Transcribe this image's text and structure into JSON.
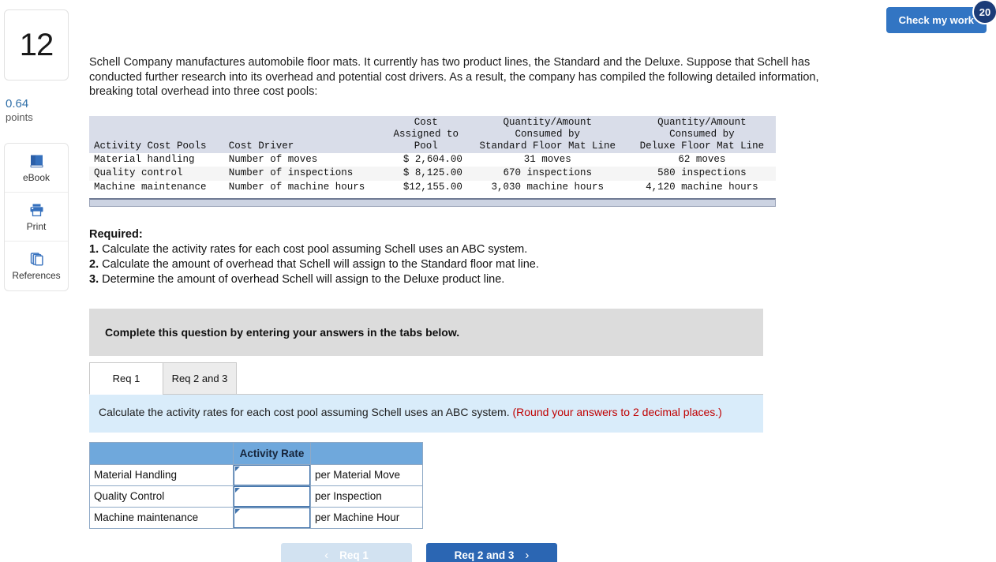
{
  "sidebar": {
    "question_number": "12",
    "points_value": "0.64",
    "points_label": "points",
    "tools": [
      {
        "label": "eBook",
        "icon": "book-icon"
      },
      {
        "label": "Print",
        "icon": "printer-icon"
      },
      {
        "label": "References",
        "icon": "copy-pages-icon"
      }
    ]
  },
  "header": {
    "check_my_work_label": "Check my work",
    "check_my_work_badge": "20"
  },
  "main": {
    "intro": "Schell Company manufactures automobile floor mats. It currently has two product lines, the Standard and the Deluxe. Suppose that Schell has conducted further research into its overhead and potential cost drivers. As a result, the company has compiled the following detailed information, breaking total overhead into three cost pools:",
    "data_table": {
      "headers": [
        "Activity Cost Pools",
        "Cost Driver",
        "Cost\nAssigned to\nPool",
        "Quantity/Amount\nConsumed by\nStandard Floor Mat Line",
        "Quantity/Amount\nConsumed by\nDeluxe Floor Mat Line"
      ],
      "rows": [
        [
          "Material handling",
          "Number of moves",
          "$ 2,604.00",
          "31 moves",
          "62 moves"
        ],
        [
          "Quality control",
          "Number of inspections",
          "$ 8,125.00",
          "670 inspections",
          "580 inspections"
        ],
        [
          "Machine maintenance",
          "Number of machine hours",
          "$12,155.00",
          "3,030 machine hours",
          "4,120 machine hours"
        ]
      ]
    },
    "required_heading": "Required:",
    "required_items": [
      {
        "num": "1.",
        "text": "Calculate the activity rates for each cost pool assuming Schell uses an ABC system."
      },
      {
        "num": "2.",
        "text": "Calculate the amount of overhead that Schell will assign to the Standard floor mat line."
      },
      {
        "num": "3.",
        "text": "Determine the amount of overhead Schell will assign to the Deluxe product line."
      }
    ],
    "banner": "Complete this question by entering your answers in the tabs below.",
    "tabs": [
      {
        "label": "Req 1",
        "active": true
      },
      {
        "label": "Req 2 and 3",
        "active": false
      }
    ],
    "prompt_text": "Calculate the activity rates for each cost pool assuming Schell uses an ABC system. ",
    "prompt_note": "(Round your answers to 2 decimal places.)",
    "answer_table": {
      "headers": [
        "",
        "Activity Rate",
        ""
      ],
      "rows": [
        {
          "label": "Material Handling",
          "value": "",
          "unit": "per Material Move"
        },
        {
          "label": "Quality Control",
          "value": "",
          "unit": "per Inspection"
        },
        {
          "label": "Machine maintenance",
          "value": "",
          "unit": "per Machine Hour"
        }
      ]
    },
    "nav": {
      "prev_label": "Req 1",
      "next_label": "Req 2 and 3",
      "prev_chevron": "‹",
      "next_chevron": "›"
    }
  },
  "colors": {
    "accent_blue": "#3275c3",
    "badge_navy": "#1b3c78",
    "table_header_blue": "#6fa8dc",
    "prompt_blue": "#d9ecfa",
    "note_red": "#c00000"
  }
}
